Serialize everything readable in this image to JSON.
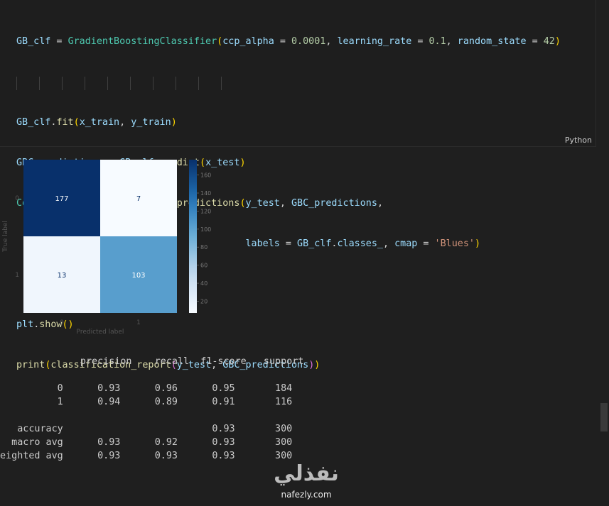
{
  "code_cell": {
    "language": "Python",
    "lines": [
      "GB_clf = GradientBoostingClassifier(ccp_alpha = 0.0001, learning_rate = 0.1, random_state = 42)",
      "",
      "GB_clf.fit(x_train, y_train)",
      "GBC_predictions = GB_clf.predict(x_test)",
      "ConfusionMatrixDisplay.from_predictions(y_test, GBC_predictions,",
      "                                        labels = GB_clf.classes_, cmap = 'Blues')",
      "",
      "plt.show()",
      "print(classification_report(y_test, GBC_predictions))"
    ]
  },
  "chart_data": {
    "type": "heatmap",
    "rows": [
      "0",
      "1"
    ],
    "cols": [
      "0",
      "1"
    ],
    "values": [
      [
        177,
        7
      ],
      [
        13,
        103
      ]
    ],
    "xlabel": "Predicted label",
    "ylabel": "True label",
    "cmap": "Blues",
    "colorbar_ticks": [
      20,
      40,
      60,
      80,
      100,
      120,
      140,
      160
    ],
    "colorbar_range": [
      7,
      177
    ]
  },
  "report": {
    "header": [
      "precision",
      "recall",
      "f1-score",
      "support"
    ],
    "rows": [
      {
        "label": "0",
        "values": [
          "0.93",
          "0.96",
          "0.95",
          "184"
        ]
      },
      {
        "label": "1",
        "values": [
          "0.94",
          "0.89",
          "0.91",
          "116"
        ]
      },
      {
        "label": "accuracy",
        "values": [
          "",
          "",
          "0.93",
          "300"
        ]
      },
      {
        "label": "macro avg",
        "values": [
          "0.93",
          "0.92",
          "0.93",
          "300"
        ]
      },
      {
        "label": "weighted avg",
        "values": [
          "0.93",
          "0.93",
          "0.93",
          "300"
        ]
      }
    ]
  },
  "watermark": {
    "logo_text": "نفذلي",
    "url": "nafezly.com"
  }
}
